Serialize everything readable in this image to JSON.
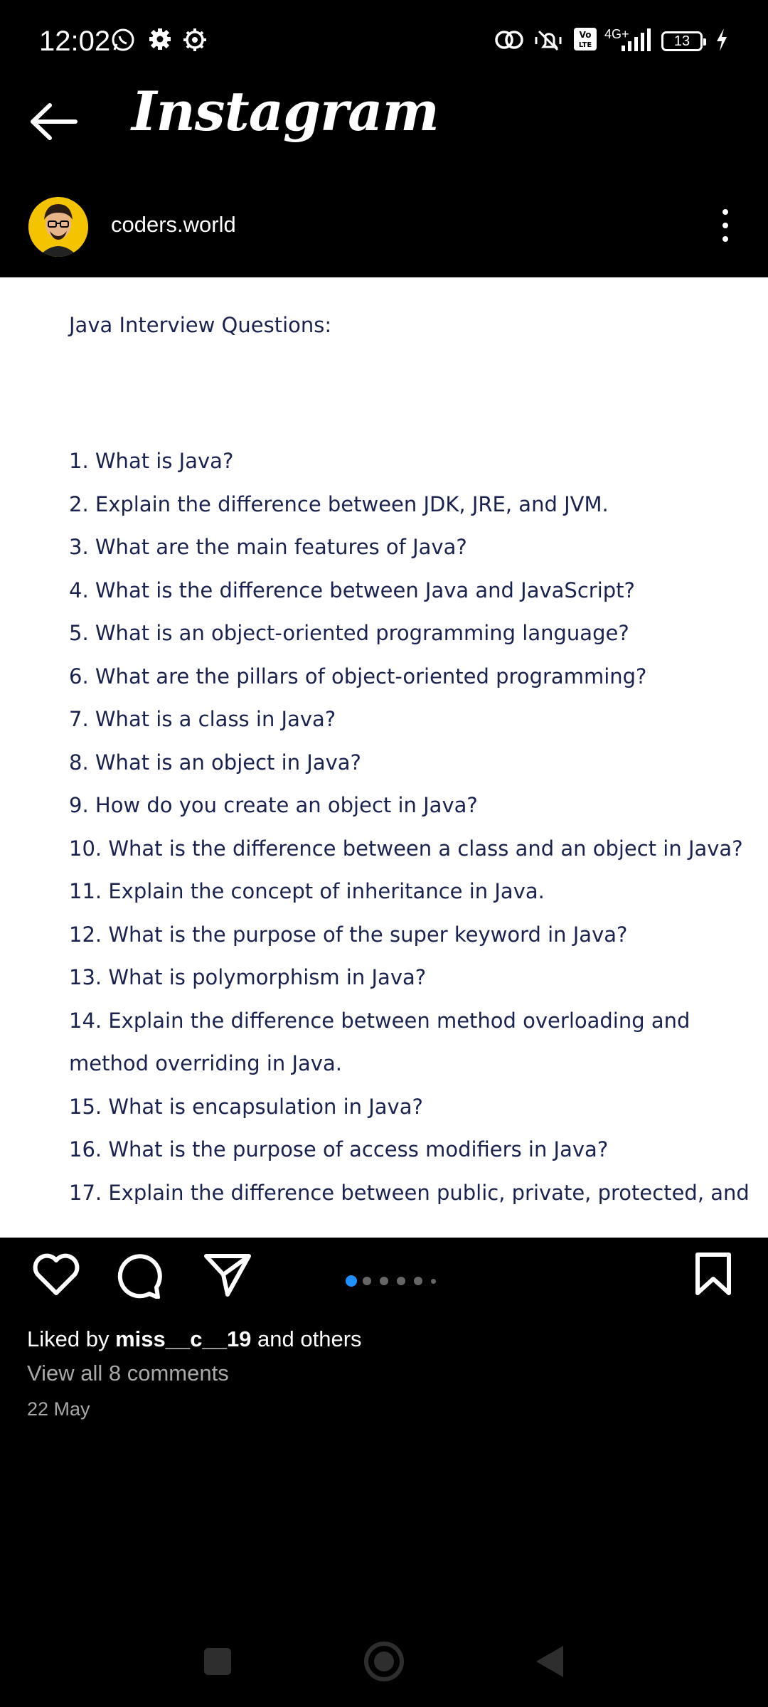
{
  "status_bar": {
    "time": "12:02",
    "network": "4G+",
    "battery": "13"
  },
  "header": {
    "brand": "Instagram"
  },
  "post": {
    "username": "coders.world",
    "document": {
      "title": "Java Interview Questions:",
      "questions": [
        "1. What is Java?",
        "2. Explain the difference between JDK, JRE, and JVM.",
        "3. What are the main features of Java?",
        "4. What is the difference between Java and JavaScript?",
        "5. What is an object-oriented programming language?",
        "6. What are the pillars of object-oriented programming?",
        "7. What is a class in Java?",
        "8. What is an object in Java?",
        "9. How do you create an object in Java?",
        "10. What is the difference between a class and an object in Java?",
        "11. Explain the concept of inheritance in Java.",
        "12. What is the purpose of the super keyword in Java?",
        "13. What is polymorphism in Java?",
        "14. Explain the difference between method overloading and",
        "method overriding in Java.",
        "15. What is encapsulation in Java?",
        "16. What is the purpose of access modifiers in Java?",
        "17. Explain the difference between public, private, protected, and"
      ]
    },
    "carousel": {
      "count": 6,
      "active": 1
    },
    "likes": {
      "prefix": "Liked by ",
      "user": "miss__c__19",
      "suffix": " and others"
    },
    "comments_link": "View all 8 comments",
    "date": "22 May"
  },
  "colors": {
    "background": "#000000",
    "post_text": "#1a2250",
    "active_dot": "#1e90ff",
    "muted": "#a8a8a8"
  },
  "icons": {
    "status": [
      "whatsapp-icon",
      "settings-icon",
      "settings-icon",
      "link-icon",
      "silent-icon",
      "volte-icon",
      "signal-icon",
      "battery-icon",
      "charging-icon"
    ],
    "actions": [
      "heart-icon",
      "comment-icon",
      "share-icon",
      "bookmark-icon"
    ],
    "nav": [
      "recents-icon",
      "home-icon",
      "back-icon"
    ]
  }
}
